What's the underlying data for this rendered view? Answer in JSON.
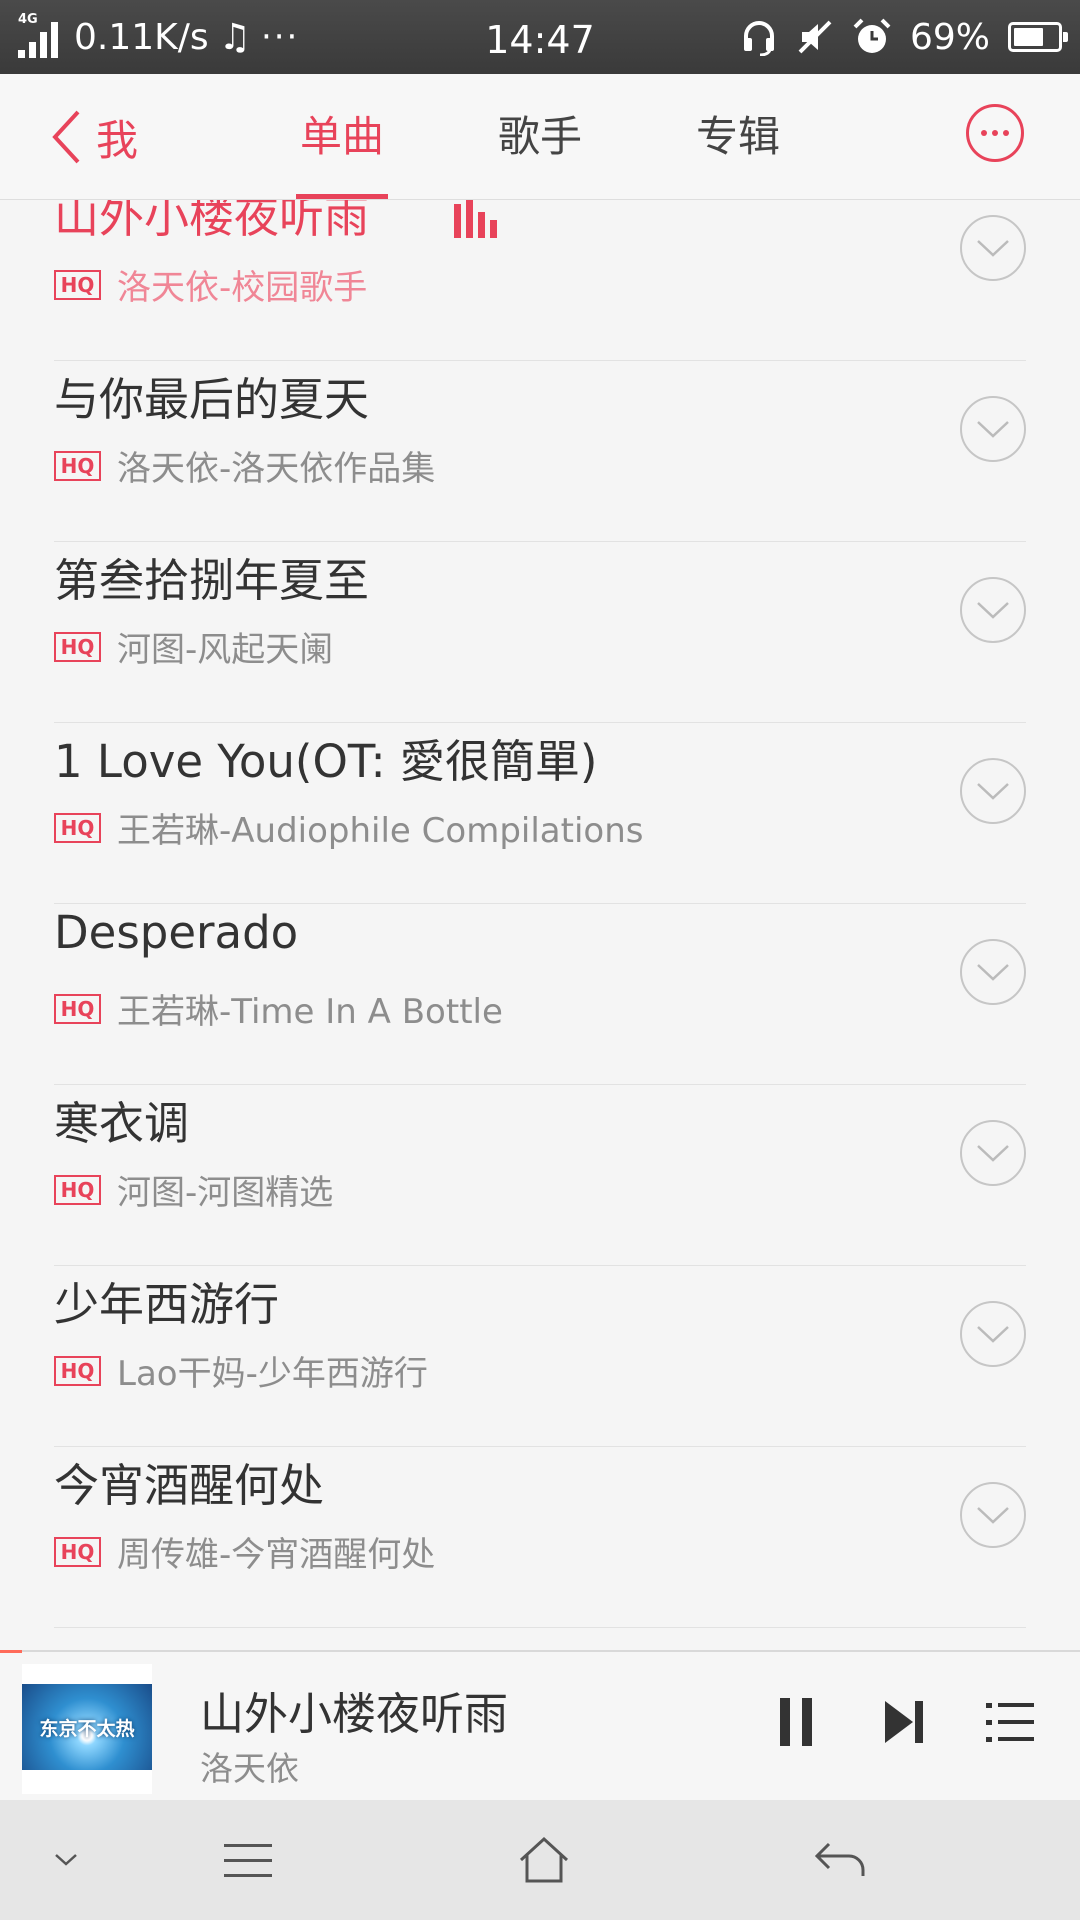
{
  "status_bar": {
    "network": "4G",
    "speed": "0.11K/s",
    "music_note": "♫",
    "dots": "···",
    "time": "14:47",
    "battery": "69%",
    "battery_level": 0.69
  },
  "header": {
    "back_label": "我",
    "tabs": [
      {
        "label": "单曲",
        "active": true
      },
      {
        "label": "歌手",
        "active": false
      },
      {
        "label": "专辑",
        "active": false
      }
    ]
  },
  "songs": [
    {
      "title": "山外小楼夜听雨",
      "badge": "HQ",
      "subtitle": "洛天依-校园歌手",
      "playing": true
    },
    {
      "title": "与你最后的夏天",
      "badge": "HQ",
      "subtitle": "洛天依-洛天依作品集"
    },
    {
      "title": "第叁拾捌年夏至",
      "badge": "HQ",
      "subtitle": "河图-风起天阑"
    },
    {
      "title": "1 Love You(OT: 愛很簡單)",
      "badge": "HQ",
      "subtitle": "王若琳-Audiophile Compilations"
    },
    {
      "title": "Desperado",
      "badge": "HQ",
      "subtitle": "王若琳-Time In A Bottle"
    },
    {
      "title": "寒衣调",
      "badge": "HQ",
      "subtitle": "河图-河图精选"
    },
    {
      "title": "少年西游行",
      "badge": "HQ",
      "subtitle": "Lao干妈-少年西游行"
    },
    {
      "title": "今宵酒醒何处",
      "badge": "HQ",
      "subtitle": "周传雄-今宵酒醒何处"
    }
  ],
  "player": {
    "cover_text": "东京不太热",
    "title": "山外小楼夜听雨",
    "artist": "洛天依",
    "progress": 0.02
  },
  "colors": {
    "accent": "#e8435a",
    "status_bar": "#3a3a3a",
    "background": "#f5f5f5"
  }
}
